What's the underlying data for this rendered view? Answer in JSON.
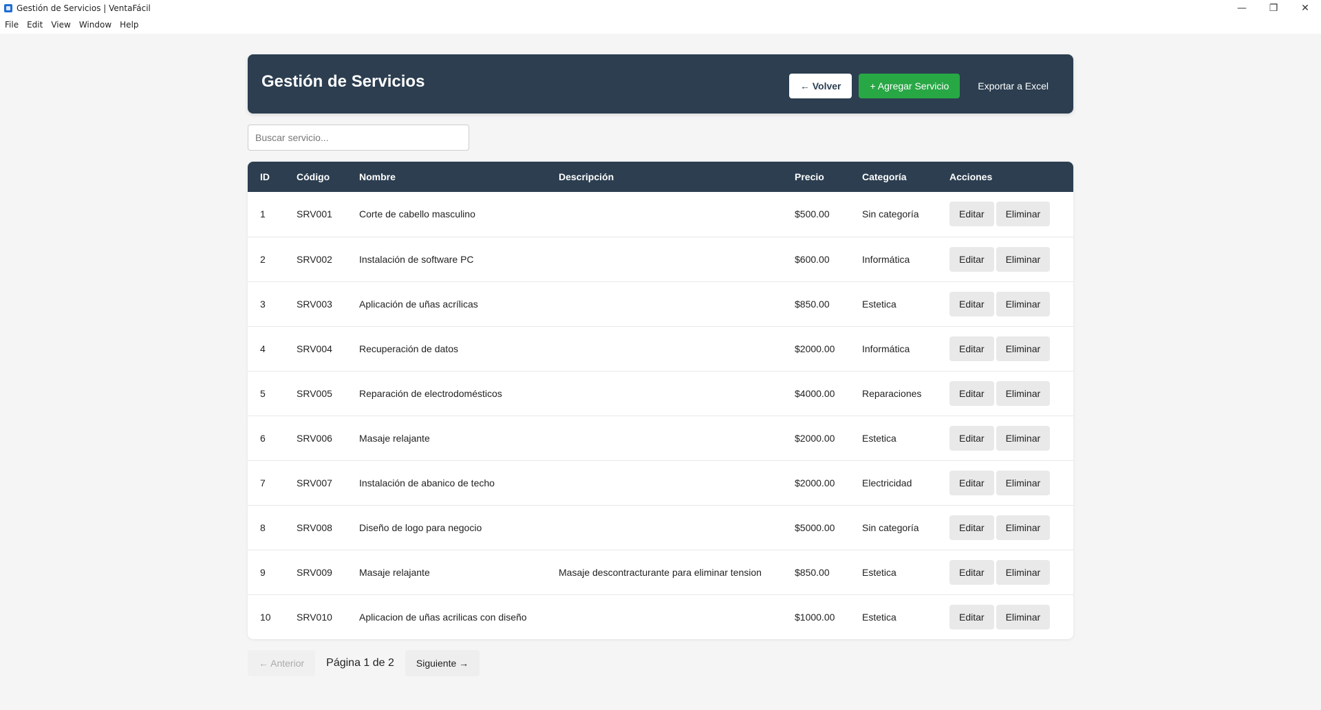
{
  "window": {
    "title": "Gestión de Servicios | VentaFácil",
    "controls": {
      "minimize": "—",
      "maximize": "❐",
      "close": "✕"
    }
  },
  "menu": [
    "File",
    "Edit",
    "View",
    "Window",
    "Help"
  ],
  "header": {
    "title": "Gestión de Servicios",
    "back_label": "← Volver",
    "add_label": "+ Agregar Servicio",
    "export_label": "Exportar a Excel"
  },
  "search": {
    "placeholder": "Buscar servicio...",
    "value": ""
  },
  "table": {
    "columns": [
      "ID",
      "Código",
      "Nombre",
      "Descripción",
      "Precio",
      "Categoría",
      "Acciones"
    ],
    "edit_label": "Editar",
    "delete_label": "Eliminar",
    "rows": [
      {
        "id": "1",
        "code": "SRV001",
        "name": "Corte de cabello masculino",
        "description": "",
        "price": "$500.00",
        "category": "Sin categoría"
      },
      {
        "id": "2",
        "code": "SRV002",
        "name": "Instalación de software PC",
        "description": "",
        "price": "$600.00",
        "category": "Informática"
      },
      {
        "id": "3",
        "code": "SRV003",
        "name": "Aplicación de uñas acrílicas",
        "description": "",
        "price": "$850.00",
        "category": "Estetica"
      },
      {
        "id": "4",
        "code": "SRV004",
        "name": "Recuperación de datos",
        "description": "",
        "price": "$2000.00",
        "category": "Informática"
      },
      {
        "id": "5",
        "code": "SRV005",
        "name": "Reparación de electrodomésticos",
        "description": "",
        "price": "$4000.00",
        "category": "Reparaciones"
      },
      {
        "id": "6",
        "code": "SRV006",
        "name": "Masaje relajante",
        "description": "",
        "price": "$2000.00",
        "category": "Estetica"
      },
      {
        "id": "7",
        "code": "SRV007",
        "name": "Instalación de abanico de techo",
        "description": "",
        "price": "$2000.00",
        "category": "Electricidad"
      },
      {
        "id": "8",
        "code": "SRV008",
        "name": "Diseño de logo para negocio",
        "description": "",
        "price": "$5000.00",
        "category": "Sin categoría"
      },
      {
        "id": "9",
        "code": "SRV009",
        "name": "Masaje relajante",
        "description": "Masaje descontracturante para eliminar tension",
        "price": "$850.00",
        "category": "Estetica"
      },
      {
        "id": "10",
        "code": "SRV010",
        "name": "Aplicacion de uñas acrilicas con diseño",
        "description": "",
        "price": "$1000.00",
        "category": "Estetica"
      }
    ]
  },
  "pagination": {
    "prev_label": "← Anterior",
    "info": "Página 1 de 2",
    "next_label": "Siguiente →"
  },
  "colors": {
    "header_bg": "#2c3e50",
    "add_button": "#28a745",
    "page_bg": "#f5f5f5"
  }
}
